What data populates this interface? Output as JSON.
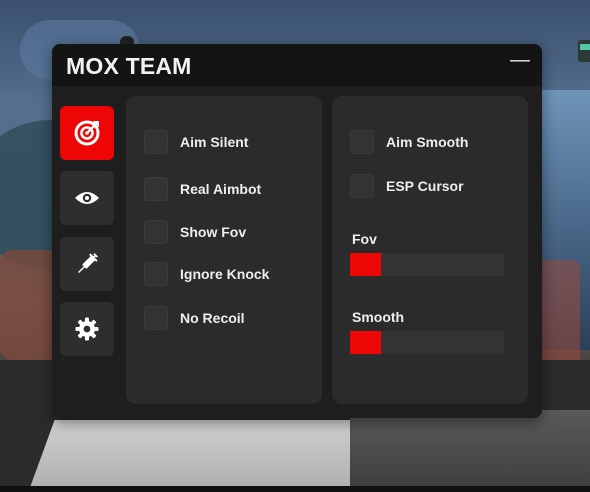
{
  "window": {
    "title": "MOX TEAM",
    "minimize_glyph": "—"
  },
  "sidebar": {
    "items": [
      {
        "icon": "target-icon",
        "active": true
      },
      {
        "icon": "eye-icon",
        "active": false
      },
      {
        "icon": "syringe-icon",
        "active": false
      },
      {
        "icon": "gear-icon",
        "active": false
      }
    ]
  },
  "left_panel": {
    "options": [
      {
        "label": "Aim Silent",
        "checked": false
      },
      {
        "label": "Real Aimbot",
        "checked": false
      },
      {
        "label": "Show Fov",
        "checked": false
      },
      {
        "label": "Ignore Knock",
        "checked": false
      },
      {
        "label": "No Recoil",
        "checked": false
      }
    ]
  },
  "right_panel": {
    "options": [
      {
        "label": "Aim Smooth",
        "checked": false
      },
      {
        "label": "ESP Cursor",
        "checked": false
      }
    ],
    "sliders": [
      {
        "label": "Fov",
        "fraction": 0.2
      },
      {
        "label": "Smooth",
        "fraction": 0.2
      }
    ]
  },
  "colors": {
    "accent": "#ee0606",
    "window_bg": "#1e1e1e",
    "panel_bg": "#2b2b2b",
    "control_bg": "#333333",
    "text": "#eeeeee"
  }
}
